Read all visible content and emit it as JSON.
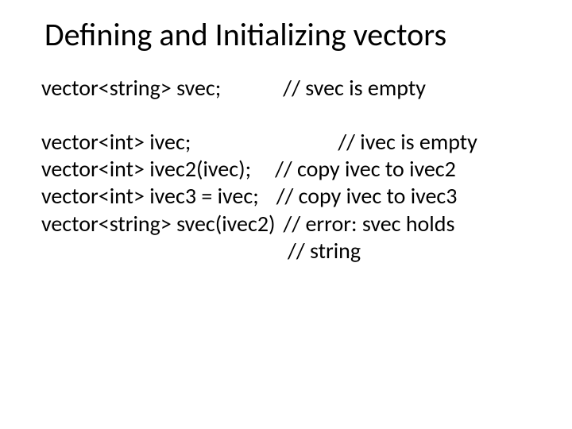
{
  "title": "Defining and Initializing vectors",
  "lines": {
    "l1_left": "vector<string> svec;",
    "l1_right": "// svec is empty",
    "l2_left": "vector<int> ivec;",
    "l2_right": "// ivec is empty",
    "l3_left": "vector<int> ivec2(ivec);",
    "l3_right": "// copy ivec to ivec2",
    "l4_left": "vector<int> ivec3 = ivec;",
    "l4_right": "// copy ivec to ivec3",
    "l5_left": "vector<string> svec(ivec2)",
    "l5_right": "// error: svec holds",
    "l6": "// string"
  }
}
